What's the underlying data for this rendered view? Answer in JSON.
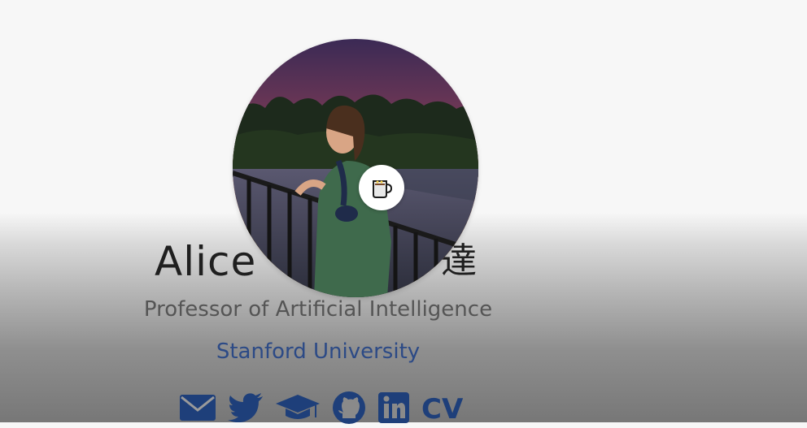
{
  "profile": {
    "name_first": "Alice",
    "name_cjk_visible": "達",
    "title": "Professor of Artificial Intelligence",
    "affiliation": "Stanford University",
    "avatar_badge_icon": "coffee-mug-icon"
  },
  "socials": [
    {
      "icon": "email-icon"
    },
    {
      "icon": "twitter-icon"
    },
    {
      "icon": "scholar-cap-icon"
    },
    {
      "icon": "github-icon"
    },
    {
      "icon": "linkedin-icon"
    },
    {
      "label": "CV"
    }
  ],
  "colors": {
    "link_blue": "#2c4a86",
    "icon_blue": "#1e3f7a",
    "text_dark": "#1f1f1f",
    "text_gray": "#555555"
  }
}
